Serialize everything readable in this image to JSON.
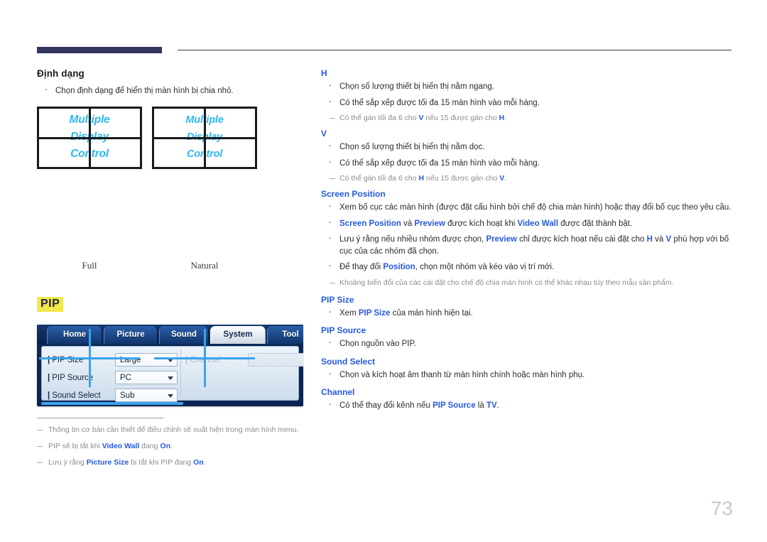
{
  "header": {
    "rule_label": "header-rule"
  },
  "left": {
    "section_title": "Định dạng",
    "bullets": [
      "Chọn định dạng để hiển thị màn hình bị chia nhỏ."
    ],
    "wall": {
      "panel_text": "Multiple\nDisplay\nControl",
      "captions": [
        "Full",
        "Natural"
      ]
    },
    "pip_tag": "PIP",
    "osd": {
      "tabs": [
        "Home",
        "Picture",
        "Sound",
        "System",
        "Tool"
      ],
      "selected_tab": "System",
      "rows": [
        {
          "label": "PIP Size",
          "value": "Large"
        },
        {
          "label": "PIP Source",
          "value": "PC"
        },
        {
          "label": "Sound Select",
          "value": "Sub"
        }
      ],
      "channel": {
        "label": "Channel",
        "value": ""
      }
    },
    "footnotes": [
      "Thông tin cơ bản cần thiết để điều chỉnh sẽ xuất hiện trong màn hình menu.",
      "PIP sẽ bị tắt khi Video Wall đang On.",
      "Lưu ý rằng Picture Size bị tắt khi PIP đang On."
    ]
  },
  "right": {
    "h": {
      "title": "H",
      "bullets": [
        "Chọn số lượng thiết bị hiển thị nằm ngang.",
        "Có thể sắp xếp được tối đa 15 màn hình vào mỗi hàng."
      ],
      "note": "Có thể gán tối đa 6 cho V nếu 15 được gán cho H."
    },
    "v": {
      "title": "V",
      "bullets": [
        "Chọn số lượng thiết bị hiển thị nằm dọc.",
        "Có thể sắp xếp được tối đa 15 màn hình vào mỗi hàng."
      ],
      "note": "Có thể gán tối đa 6 cho H nếu 15 được gán cho V."
    },
    "screen_position": {
      "title": "Screen Position",
      "bullets": [
        "Xem bố cục các màn hình (được đặt cấu hình bởi chế độ chia màn hình) hoặc thay đổi bố cục theo yêu cầu.",
        "Screen Position và Preview được kích hoạt khi Video Wall được đặt thành bật.",
        "Lưu ý rằng nếu nhiều nhóm được chọn, Preview chỉ được kích hoạt nếu cài đặt cho H và V phù hợp với bố cục của các nhóm đã chọn.",
        "Để thay đổi Position, chọn một nhóm và kéo vào vị trí mới."
      ],
      "note": "Khoảng biến đổi của các cài đặt cho chế độ chia màn hình có thể khác nhau tùy theo mẫu sản phẩm."
    },
    "pip_size": {
      "title": "PIP Size",
      "bullets": [
        "Xem PIP Size của màn hình hiện tại."
      ]
    },
    "pip_source": {
      "title": "PIP Source",
      "bullets": [
        "Chọn nguồn vào PIP."
      ]
    },
    "sound_select": {
      "title": "Sound Select",
      "bullets": [
        "Chọn và kích hoạt âm thanh từ màn hình chính hoặc màn hình phụ."
      ]
    },
    "channel": {
      "title": "Channel",
      "bullets": [
        "Có thể thay đổi kênh nếu PIP Source là TV."
      ]
    }
  },
  "page_number": "73",
  "colors": {
    "accent_blue": "#2559e0",
    "header_bar": "#32355e",
    "highlight_yellow": "#f2e74b",
    "wall_text": "#2eb8f0",
    "photo_border": "#3ba3ee",
    "page_number": "#c9c9c9"
  }
}
